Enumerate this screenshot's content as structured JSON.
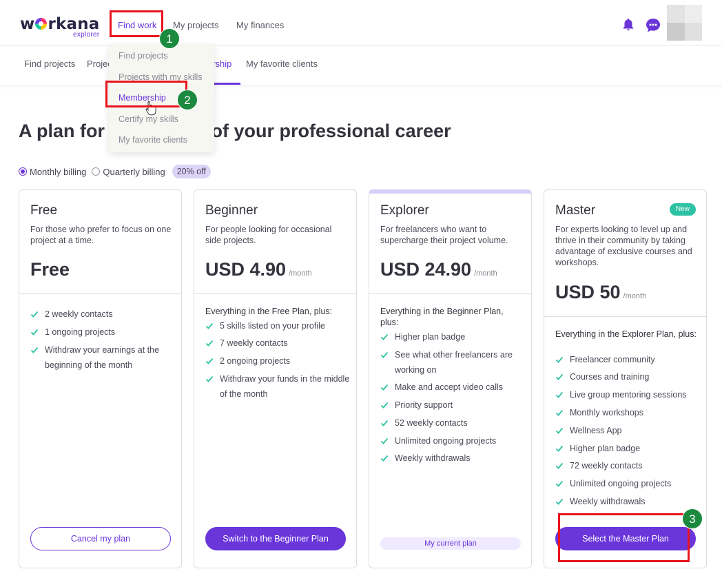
{
  "brand": {
    "name_left": "w",
    "name_right": "rkana",
    "tagline": "explorer"
  },
  "topnav": {
    "find_work": "Find work",
    "my_projects": "My projects",
    "my_finances": "My finances"
  },
  "subnav": {
    "find_projects": "Find projects",
    "projects_partial": "Projec",
    "membership_partial": "ership",
    "favorite_clients": "My favorite clients"
  },
  "dropdown": {
    "items": [
      "Find projects",
      "Projects with my skills",
      "Membership",
      "Certify my skills",
      "My favorite clients"
    ]
  },
  "callouts": [
    "1",
    "2",
    "3"
  ],
  "heading": {
    "left": "A plan for",
    "right": "e of your professional career"
  },
  "billing": {
    "monthly": "Monthly billing",
    "quarterly": "Quarterly billing",
    "discount": "20% off",
    "selected": "monthly"
  },
  "plans": [
    {
      "name": "Free",
      "desc": "For those who prefer to focus on one project at a time.",
      "price": "Free",
      "per": "",
      "lead": "",
      "features": [
        "2 weekly contacts",
        "1 ongoing projects",
        "Withdraw your earnings at the beginning of the month"
      ],
      "button": "Cancel my plan"
    },
    {
      "name": "Beginner",
      "desc": "For people looking for occasional side projects.",
      "price": "USD 4.90",
      "per": "/month",
      "lead": "Everything in the Free Plan, plus:",
      "features": [
        "5 skills listed on your profile",
        "7 weekly contacts",
        "2 ongoing projects",
        "Withdraw your funds in the middle of the month"
      ],
      "button": "Switch to the Beginner Plan"
    },
    {
      "name": "Explorer",
      "desc": "For freelancers who want to supercharge their project volume.",
      "price": "USD 24.90",
      "per": "/month",
      "lead": "Everything in the Beginner Plan, plus:",
      "features": [
        "Higher plan badge",
        "See what other freelancers are working on",
        "Make and accept video calls",
        "Priority support",
        "52 weekly contacts",
        "Unlimited ongoing projects",
        "Weekly withdrawals"
      ],
      "button": "My current plan"
    },
    {
      "name": "Master",
      "tag": "New",
      "desc": "For experts looking to level up and thrive in their community by taking advantage of exclusive courses and workshops.",
      "price": "USD 50",
      "per": "/month",
      "lead": "Everything in the Explorer Plan, plus:",
      "features": [
        "Freelancer community",
        "Courses and training",
        "Live group mentoring sessions",
        "Monthly workshops",
        "Wellness App",
        "Higher plan badge",
        "72 weekly contacts",
        "Unlimited ongoing projects",
        "Weekly withdrawals"
      ],
      "button": "Select the Master Plan"
    }
  ],
  "colors": {
    "accent": "#6a35d9",
    "check": "#2dc2a3",
    "callout": "#e8141c",
    "badge": "#1b8a3e"
  }
}
